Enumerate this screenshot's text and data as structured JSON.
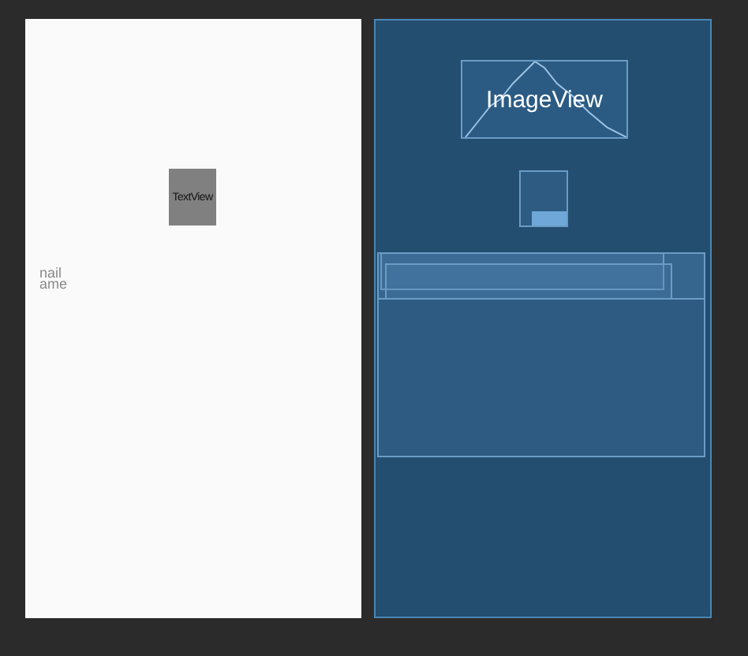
{
  "design": {
    "widgets": [
      {
        "kind": "box",
        "text": "TextView"
      },
      {
        "kind": "label",
        "text": "nail"
      },
      {
        "kind": "label",
        "text": "ame"
      }
    ]
  },
  "blueprint": {
    "image_view": {
      "label": "ImageView"
    }
  }
}
